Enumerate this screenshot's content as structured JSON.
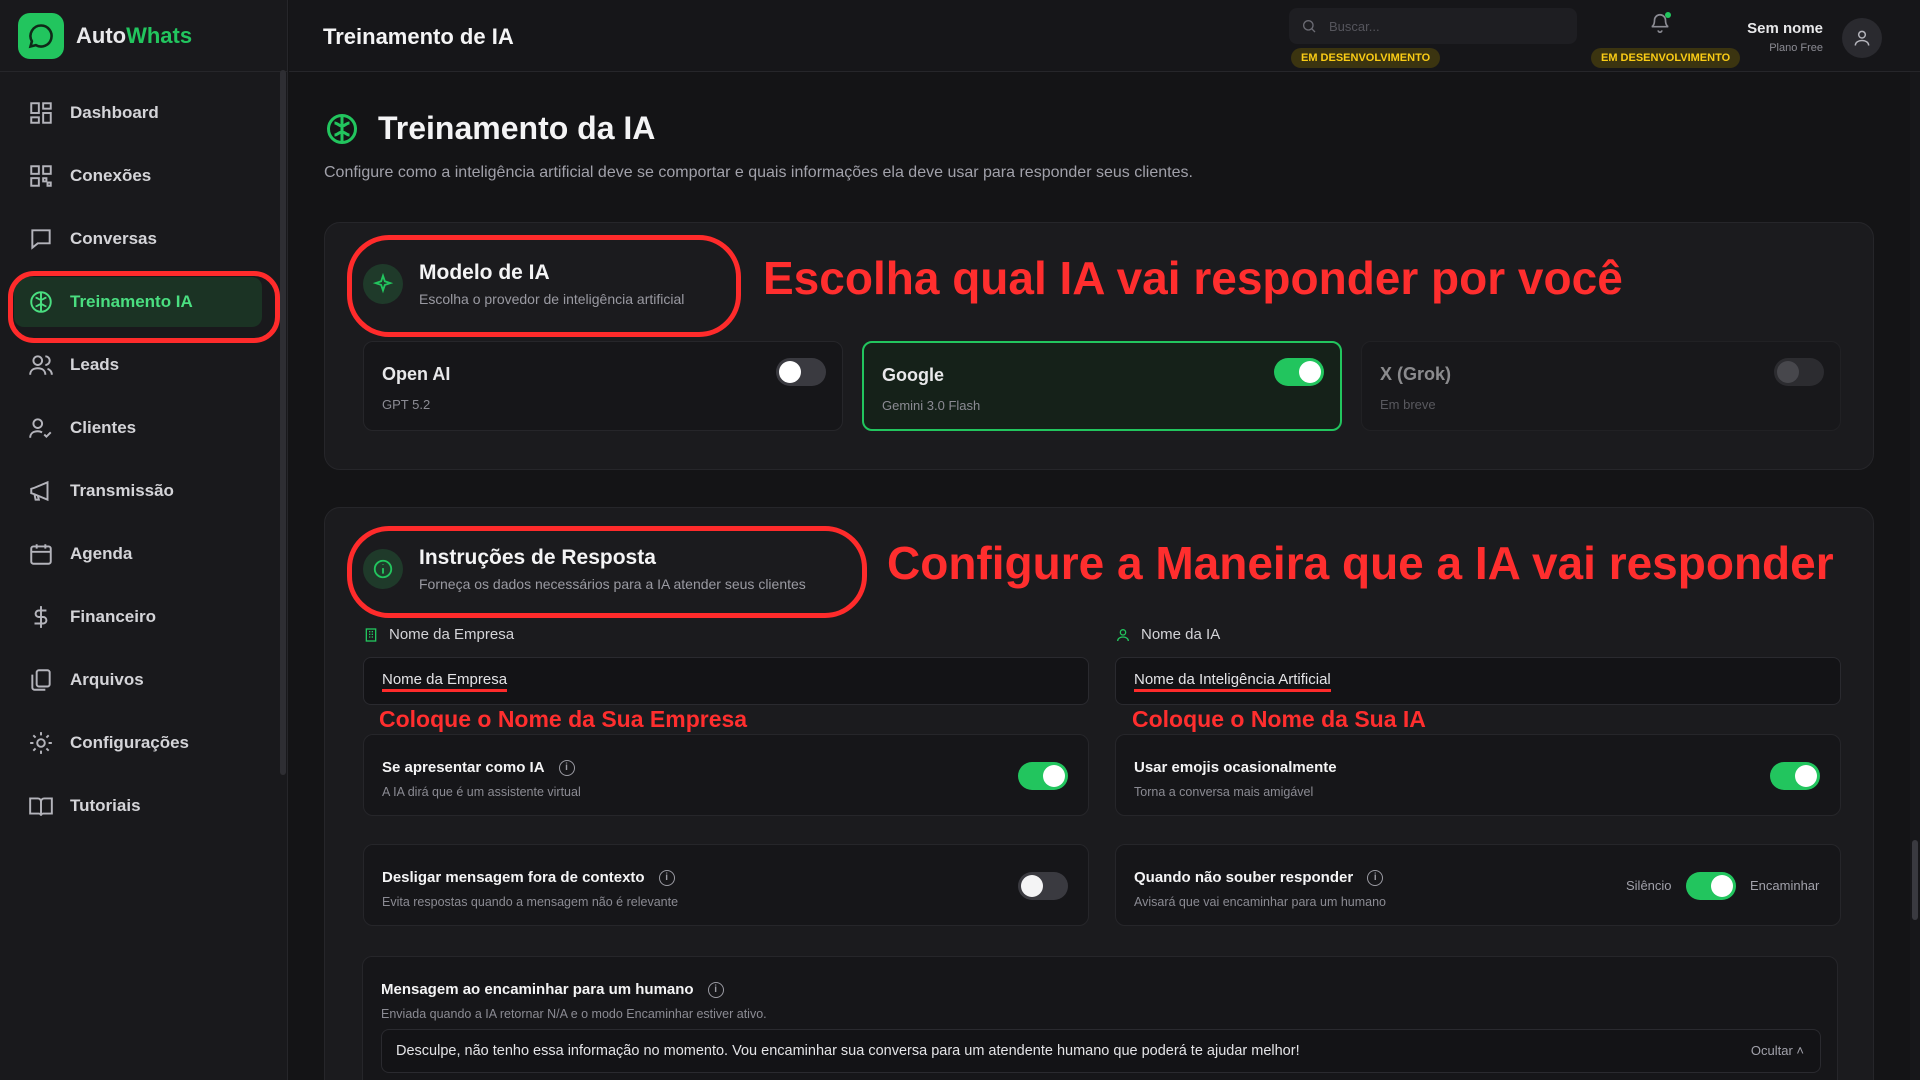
{
  "app": {
    "brand_part1": "Auto",
    "brand_part2": "Whats"
  },
  "sidebar": {
    "items": [
      {
        "label": "Dashboard",
        "icon": "grid-icon"
      },
      {
        "label": "Conexões",
        "icon": "qrcode-icon"
      },
      {
        "label": "Conversas",
        "icon": "chat-icon"
      },
      {
        "label": "Treinamento IA",
        "icon": "brain-icon",
        "active": true
      },
      {
        "label": "Leads",
        "icon": "users-icon"
      },
      {
        "label": "Clientes",
        "icon": "user-check-icon"
      },
      {
        "label": "Transmissão",
        "icon": "megaphone-icon"
      },
      {
        "label": "Agenda",
        "icon": "calendar-icon"
      },
      {
        "label": "Financeiro",
        "icon": "dollar-icon"
      },
      {
        "label": "Arquivos",
        "icon": "files-icon"
      },
      {
        "label": "Configurações",
        "icon": "gear-icon"
      },
      {
        "label": "Tutoriais",
        "icon": "book-icon"
      }
    ]
  },
  "header": {
    "title": "Treinamento de IA",
    "search_placeholder": "Buscar...",
    "dev_badge_search": "EM DESENVOLVIMENTO",
    "dev_badge_bell": "EM DESENVOLVIMENTO",
    "user_name": "Sem nome",
    "user_plan": "Plano Free"
  },
  "page": {
    "title": "Treinamento da IA",
    "subtitle": "Configure como a inteligência artificial deve se comportar e quais informações ela deve usar para responder seus clientes."
  },
  "model_section": {
    "title": "Modelo de IA",
    "desc": "Escolha o provedor de inteligência artificial",
    "annotation": "Escolha qual IA vai responder por você",
    "providers": [
      {
        "name": "Open AI",
        "model": "GPT 5.2",
        "enabled": false
      },
      {
        "name": "Google",
        "model": "Gemini 3.0 Flash",
        "enabled": true
      },
      {
        "name": "X (Grok)",
        "model": "Em breve",
        "enabled": false
      }
    ]
  },
  "instructions_section": {
    "title": "Instruções de Resposta",
    "desc": "Forneça os dados necessários para a IA atender seus clientes",
    "annotation": "Configure a Maneira que a IA vai responder",
    "company_label": "Nome da Empresa",
    "company_placeholder": "Nome da Empresa",
    "company_annotation": "Coloque o Nome da Sua Empresa",
    "ai_label": "Nome da IA",
    "ai_placeholder": "Nome da Inteligência Artificial",
    "ai_annotation": "Coloque o Nome da Sua IA",
    "options": [
      {
        "title": "Se apresentar como IA",
        "desc": "A IA dirá que é um assistente virtual",
        "on": true
      },
      {
        "title": "Usar emojis ocasionalmente",
        "desc": "Torna a conversa mais amigável",
        "on": true
      },
      {
        "title": "Desligar mensagem fora de contexto",
        "desc": "Evita respostas quando a mensagem não é relevante",
        "on": false
      },
      {
        "title": "Quando não souber responder",
        "desc": "Avisará que vai encaminhar para um humano",
        "on": true,
        "left_label": "Silêncio",
        "right_label": "Encaminhar"
      }
    ],
    "handoff": {
      "title": "Mensagem ao encaminhar para um humano",
      "desc": "Enviada quando a IA retornar N/A e o modo Encaminhar estiver ativo.",
      "message": "Desculpe, não tenho essa informação no momento. Vou encaminhar sua conversa para um atendente humano que poderá te ajudar melhor!",
      "hide_label": "Ocultar"
    }
  },
  "colors": {
    "accent": "#22c55e",
    "annotation": "#ff2b2b",
    "badge": "#facc15"
  }
}
